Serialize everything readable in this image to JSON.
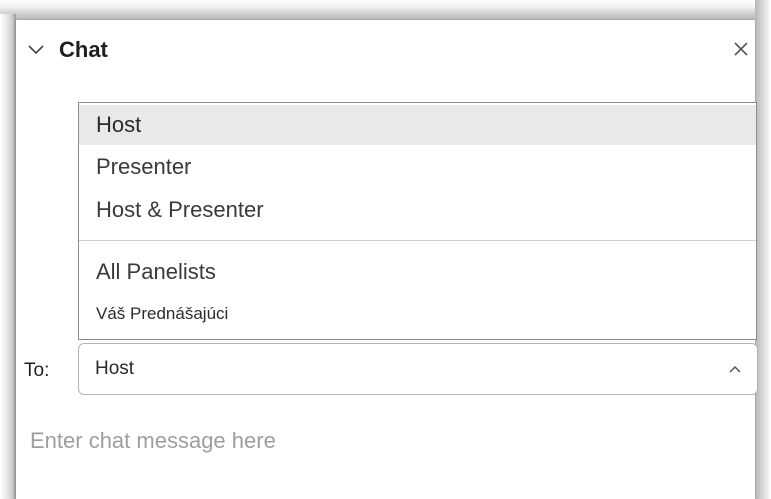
{
  "panel": {
    "title": "Chat",
    "collapse_icon": "chevron-down-icon",
    "close_icon": "close-icon"
  },
  "recipient_dropdown": {
    "options": [
      {
        "label": "Host",
        "highlighted": true
      },
      {
        "label": "Presenter",
        "highlighted": false
      },
      {
        "label": "Host & Presenter",
        "highlighted": false
      },
      {
        "label": "All Panelists",
        "highlighted": false
      },
      {
        "label": "Váš Prednášajúci",
        "highlighted": false
      }
    ]
  },
  "to_field": {
    "label": "To:",
    "selected_value": "Host",
    "icon": "chevron-up-icon"
  },
  "message": {
    "placeholder": "Enter chat message here",
    "value": ""
  },
  "colors": {
    "highlight": "#e9e9e9",
    "border": "#8c8c8c",
    "placeholder": "#9e9e9e"
  }
}
